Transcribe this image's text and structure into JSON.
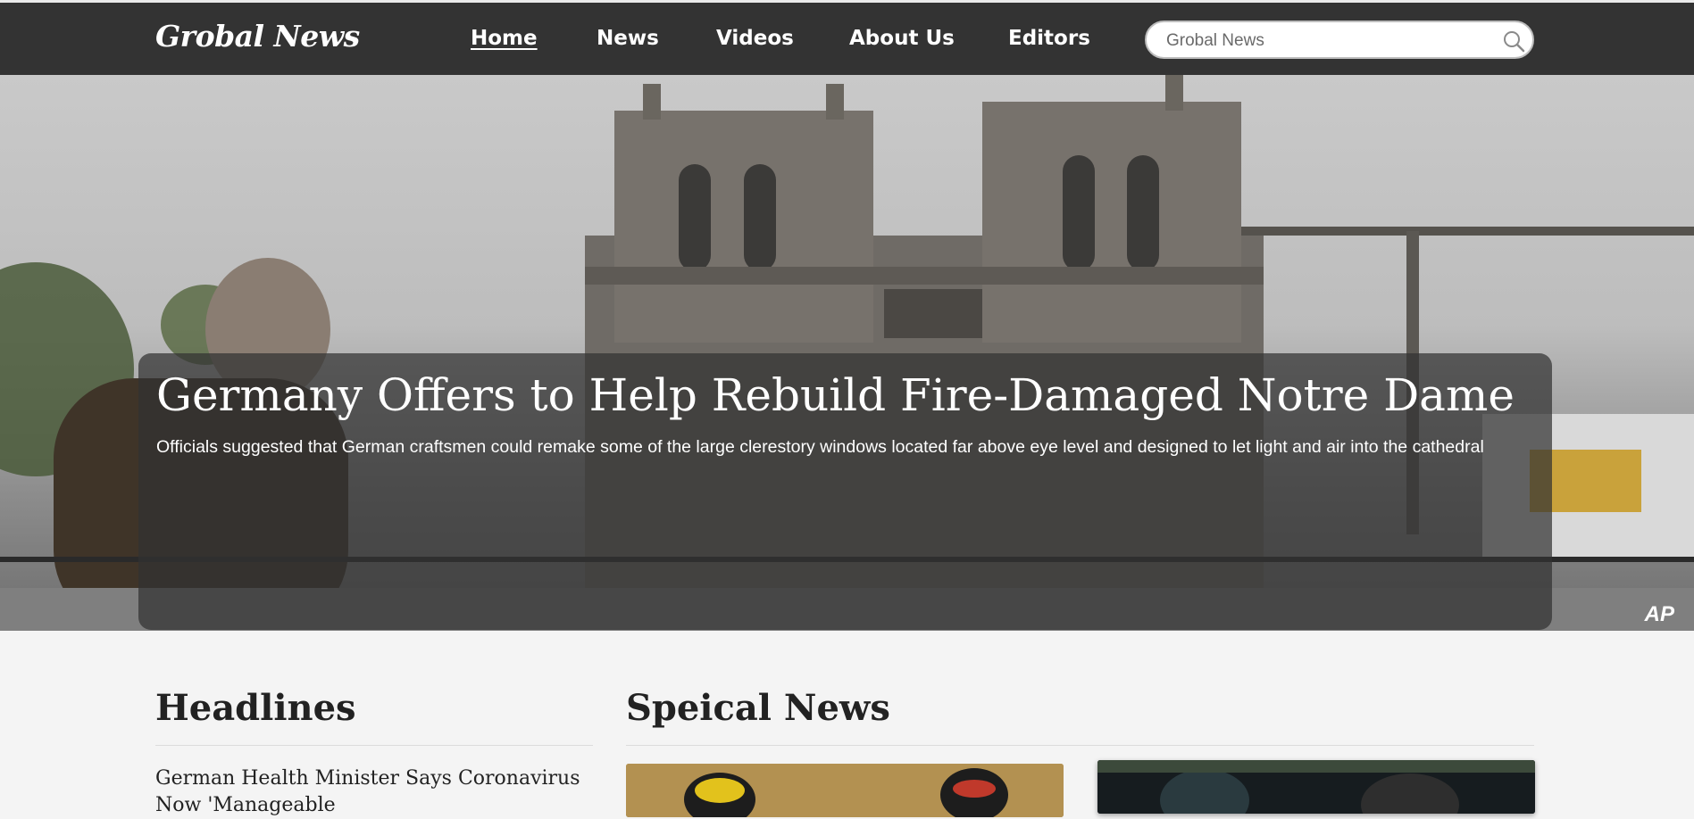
{
  "header": {
    "logo": "Grobal News",
    "nav": [
      {
        "label": "Home",
        "active": true
      },
      {
        "label": "News",
        "active": false
      },
      {
        "label": "Videos",
        "active": false
      },
      {
        "label": "About Us",
        "active": false
      },
      {
        "label": "Editors",
        "active": false
      }
    ],
    "search": {
      "placeholder": "Grobal News",
      "icon": "search-icon"
    }
  },
  "hero": {
    "title": "Germany Offers to Help Rebuild Fire-Damaged Notre Dame",
    "subtitle": "Officials suggested that German craftsmen could remake some of the large clerestory windows located far above eye level and designed to let light and air into the cathedral",
    "photo_credit": "AP"
  },
  "headlines": {
    "heading": "Headlines",
    "items": [
      "German Health Minister Says Coronavirus Now 'Manageable"
    ]
  },
  "special_news": {
    "heading": "Speical News"
  },
  "colors": {
    "topbar": "#333333",
    "page_background": "#f4f4f4",
    "caption_overlay": "rgba(50,50,50,0.72)"
  }
}
